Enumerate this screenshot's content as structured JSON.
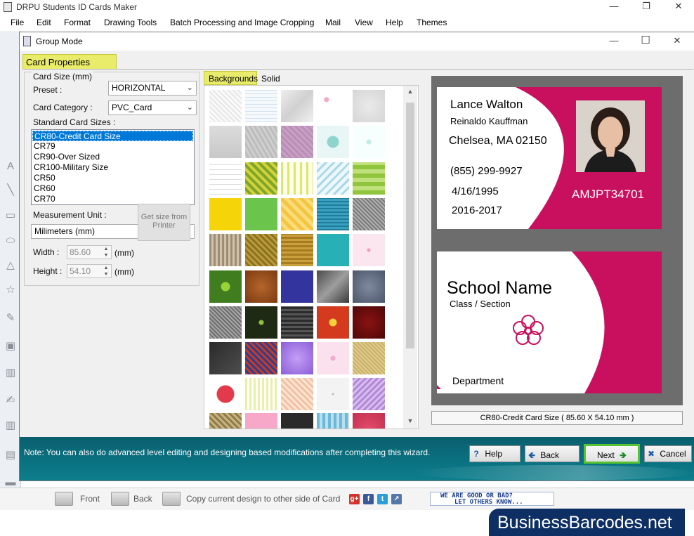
{
  "app": {
    "title": "DRPU Students ID Cards Maker",
    "window_buttons": [
      "—",
      "❐",
      "✕"
    ]
  },
  "menu": [
    "File",
    "Edit",
    "Format",
    "Drawing Tools",
    "Batch Processing and Image Cropping",
    "Mail",
    "View",
    "Help",
    "Themes"
  ],
  "dialog": {
    "title": "Group Mode",
    "window_buttons": [
      "—",
      "☐",
      "✕"
    ],
    "tab": "Card Properties",
    "card_size": {
      "group_label": "Card Size (mm)",
      "preset_label": "Preset :",
      "preset_value": "HORIZONTAL",
      "category_label": "Card Category :",
      "category_value": "PVC_Card",
      "standard_label": "Standard Card Sizes :",
      "sizes": [
        "CR80-Credit Card Size",
        "CR79",
        "CR90-Over Sized",
        "CR100-Military Size",
        "CR50",
        "CR60",
        "CR70"
      ],
      "selected_index": 0,
      "unit_label": "Measurement Unit :",
      "unit_value": "Milimeters (mm)",
      "width_label": "Width :",
      "width_value": "85.60",
      "width_unit": "(mm)",
      "height_label": "Height :",
      "height_value": "54.10",
      "height_unit": "(mm)",
      "get_size_button": "Get size from Printer"
    },
    "background_tabs": {
      "backgrounds": "Backgrounds",
      "solid_color": "Solid Color"
    },
    "scroll_arrows": {
      "up": "▲",
      "down": "▼"
    },
    "preview": {
      "front": {
        "name": "Lance Walton",
        "parent": "Reinaldo Kauffman",
        "address": "Chelsea, MA 02150",
        "phone": "(855) 299-9927",
        "dob": "4/16/1995",
        "session": "2016-2017",
        "id_number": "AMJPT34701",
        "accent_color": "#c8105e"
      },
      "back": {
        "school_name": "School Name",
        "class_section": "Class / Section",
        "department": "Department",
        "accent_color": "#c8105e"
      },
      "size_caption": "CR80-Credit Card Size ( 85.60 X 54.10 mm )"
    },
    "note": "Note: You can also do advanced level editing and designing based modifications after completing this wizard.",
    "buttons": {
      "help": "Help",
      "back": "Back",
      "next": "Next",
      "cancel": "Cancel"
    }
  },
  "bottom_toolbar": {
    "front": "Front",
    "back": "Back",
    "copy": "Copy current design to other side of Card",
    "social": [
      "g+",
      "f",
      "t",
      "↗"
    ],
    "feedback_line1": "WE ARE GOOD OR BAD?",
    "feedback_line2": "LET OTHERS KNOW..."
  },
  "brand": "BusinessBarcodes.net"
}
